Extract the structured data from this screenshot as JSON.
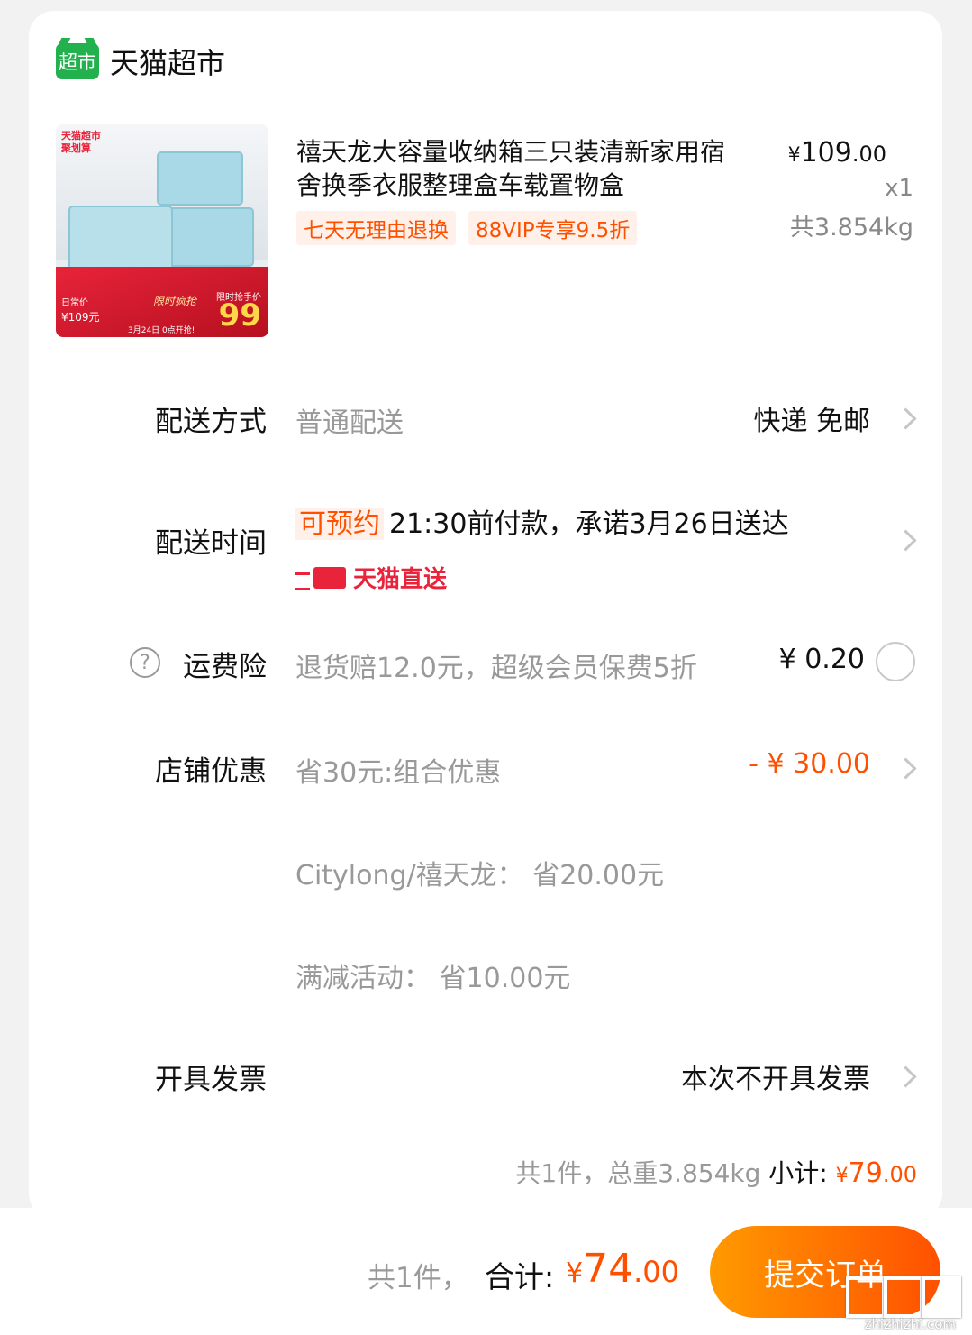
{
  "shop": {
    "logo_text": "超市",
    "name": "天猫超市"
  },
  "product": {
    "image_texts": {
      "top": "天猫超市",
      "top2": "聚划算",
      "daily_label": "日常价",
      "daily_price": "¥109元",
      "flash": "限时疯抢",
      "limited_label": "限时抢手价",
      "big_price": "99",
      "date": "3月24日 0点开抢!"
    },
    "title": "禧天龙大容量收纳箱三只装清新家用宿舍换季衣服整理盒车载置物盒",
    "tags": [
      "七天无理由退换",
      "88VIP专享9.5折"
    ],
    "price_yen": "¥",
    "price_int": "109",
    "price_dec": ".00",
    "qty": "x1",
    "weight": "共3.854kg"
  },
  "delivery_method": {
    "label": "配送方式",
    "value": "普通配送",
    "right": "快递 免邮"
  },
  "delivery_time": {
    "label": "配送时间",
    "preorder": "可预约",
    "value": "21:30前付款，承诺3月26日送达",
    "direct": "天猫直送"
  },
  "shipping_insurance": {
    "help": "?",
    "label": "运费险",
    "value": "退货赔12.0元，超级会员保费5折",
    "price": "¥ 0.20"
  },
  "store_discount": {
    "label": "店铺优惠",
    "value": "省30元:组合优惠",
    "amount": "- ¥ 30.00",
    "details": [
      "Citylong/禧天龙：  省20.00元",
      "满减活动：  省10.00元"
    ]
  },
  "invoice": {
    "label": "开具发票",
    "value": "本次不开具发票"
  },
  "subtotal": {
    "info": "共1件，总重3.854kg",
    "label": "小计:",
    "yen": "¥",
    "int": "79",
    "dec": ".00"
  },
  "footer": {
    "count": "共1件，",
    "total_label": "合计:",
    "total_yen": "¥",
    "total_int": "74",
    "total_dec": ".00",
    "submit": "提交订单"
  },
  "watermark": {
    "text": "zhizhizhi.com"
  },
  "colors": {
    "accent": "#ff5000",
    "tmall_red": "#e8233a",
    "supermarket_green": "#22b14c"
  }
}
